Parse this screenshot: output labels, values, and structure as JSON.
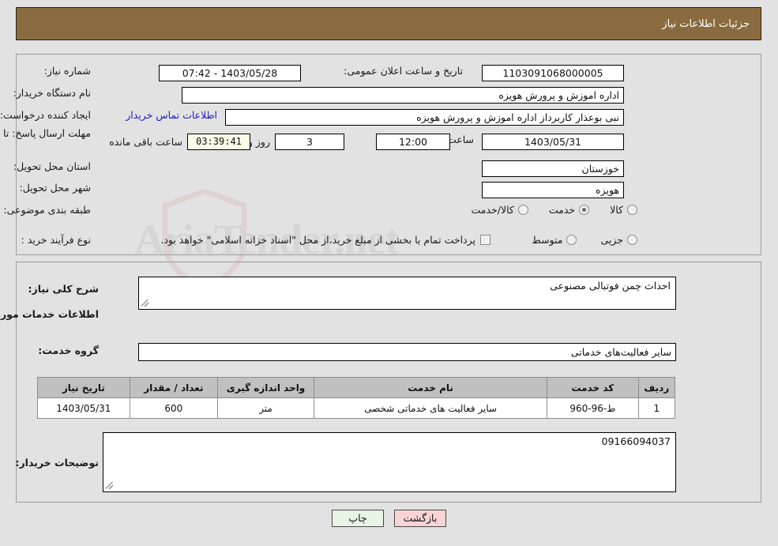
{
  "header": {
    "title": "جزئیات اطلاعات نیاز",
    "bg": "#8a6b3f"
  },
  "top": {
    "need_number_label": "شماره نیاز:",
    "need_number_value": "1103091068000005",
    "announce_label": "تاریخ و ساعت اعلان عمومی:",
    "announce_value": "1403/05/28 - 07:42",
    "buyer_org_label": "نام دستگاه خریدار:",
    "buyer_org_value": "اداره اموزش و پرورش هویزه",
    "requester_label": "ایجاد کننده درخواست:",
    "requester_value": "نبی بوعذار کاربرداز اداره اموزش و پرورش هویزه",
    "contact_link": "اطلاعات تماس خریدار",
    "deadline_label": "مهلت ارسال پاسخ: تا تاریخ:",
    "deadline_date": "1403/05/31",
    "hour_label": "ساعت",
    "deadline_hour": "12:00",
    "days_value": "3",
    "days_label": "روز و",
    "timer_value": "03:39:41",
    "remaining_label": "ساعت باقی مانده",
    "province_label": "استان محل تحویل:",
    "province_value": "خوزستان",
    "city_label": "شهر محل تحویل:",
    "city_value": "هویزه",
    "category_label": "طبقه بندی موضوعی:",
    "category_options": [
      {
        "label": "کالا",
        "selected": false
      },
      {
        "label": "خدمت",
        "selected": true
      },
      {
        "label": "کالا/خدمت",
        "selected": false
      }
    ],
    "process_label": "نوع فرآیند خرید :",
    "process_options": [
      {
        "label": "جزیی",
        "selected": false
      },
      {
        "label": "متوسط",
        "selected": false
      }
    ],
    "treasury_checkbox_label": "پرداخت تمام یا بخشی از مبلغ خرید،از محل \"اسناد خزانه اسلامی\" خواهد بود.",
    "treasury_checked": false
  },
  "mid": {
    "general_desc_label": "شرح کلی نیاز:",
    "general_desc_value": "احداث چمن فوتبالی مصنوعی",
    "services_section_title": "اطلاعات خدمات مورد نیاز",
    "service_group_label": "گروه خدمت:",
    "service_group_value": "سایر فعالیت‌های خدماتی",
    "buyer_comments_label": "توضیحات خریدار:",
    "buyer_comments_value": "09166094037"
  },
  "table": {
    "columns": [
      "ردیف",
      "کد خدمت",
      "نام خدمت",
      "واحد اندازه گیری",
      "تعداد / مقدار",
      "تاریخ نیاز"
    ],
    "rows": [
      {
        "row_no": "1",
        "service_code": "ط-96-960",
        "service_name": "سایر فعالیت های خدماتی شخصی",
        "unit": "متر",
        "quantity": "600",
        "need_date": "1403/05/31"
      }
    ]
  },
  "footer": {
    "print_label": "چاپ",
    "back_label": "بازگشت"
  },
  "watermark": {
    "text": "AriaTender.net"
  }
}
